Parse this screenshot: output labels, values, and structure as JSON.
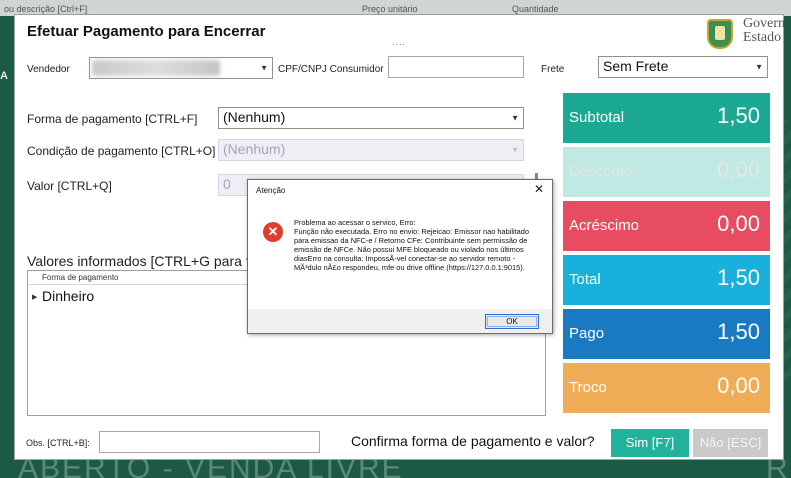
{
  "background": {
    "columns": [
      "ou descrição [Ctrl+F]",
      "Preço unitário",
      "Quantidade"
    ],
    "left_letter": "A",
    "status_left": "ABERTO - VENDA LIVRE",
    "status_right": "R"
  },
  "dialog": {
    "title": "Efetuar Pagamento para Encerrar",
    "dots": "....",
    "gov_line1": "Govern",
    "gov_line2": "Estado"
  },
  "form": {
    "vendedor_label": "Vendedor",
    "cpf_label": "CPF/CNPJ Consumidor",
    "cpf_value": "",
    "frete_label": "Frete",
    "frete_value": "Sem Frete",
    "forma_label": "Forma de pagamento [CTRL+F]",
    "forma_value": "(Nenhum)",
    "condicao_label": "Condição de pagamento [CTRL+O]",
    "condicao_value": "(Nenhum)",
    "valor_label": "Valor [CTRL+Q]",
    "valor_value": "0",
    "valores_label": "Valores informados [CTRL+G para f",
    "obs_label": "Obs. [CTRL+B]:",
    "obs_value": ""
  },
  "grid": {
    "header": "Forma de pagamento",
    "rows": [
      "Dinheiro"
    ]
  },
  "summary": {
    "subtotal_label": "Subtotal",
    "subtotal_value": "1,50",
    "desconto_label": "Desconto",
    "desconto_value": "0,00",
    "acrescimo_label": "Acréscimo",
    "acrescimo_value": "0,00",
    "total_label": "Total",
    "total_value": "1,50",
    "pago_label": "Pago",
    "pago_value": "1,50",
    "troco_label": "Troco",
    "troco_value": "0,00"
  },
  "footer": {
    "question": "Confirma forma de pagamento e valor?",
    "yes_label": "Sim [F7]",
    "no_label": "Não [ESC]"
  },
  "alert": {
    "title": "Atenção",
    "close": "✕",
    "icon": "error-icon",
    "message": "Problema ao acessar o servico, Erro:\nFunção não executada. Erro no envio: Rejeicao: Emissor nao habilitado para emissao da NFC-e / Retorno CFe: Contribuinte sem permissão de emissão de NFCe. Não possui MFE bloqueado ou violado nos últimos diasErro na consulta: ImpossÃ-vel conectar-se ao servidor remoto - MÃ³dulo nÃ£o respondeu, mfe ou drive offline (https://127.0.0.1:9015).",
    "ok_label": "OK"
  },
  "colors": {
    "subtotal": "#1ba994",
    "desconto": "#bfe9e2",
    "acrescimo": "#e84c63",
    "total": "#19b1dc",
    "pago": "#1979c2",
    "troco": "#f0ad57"
  }
}
